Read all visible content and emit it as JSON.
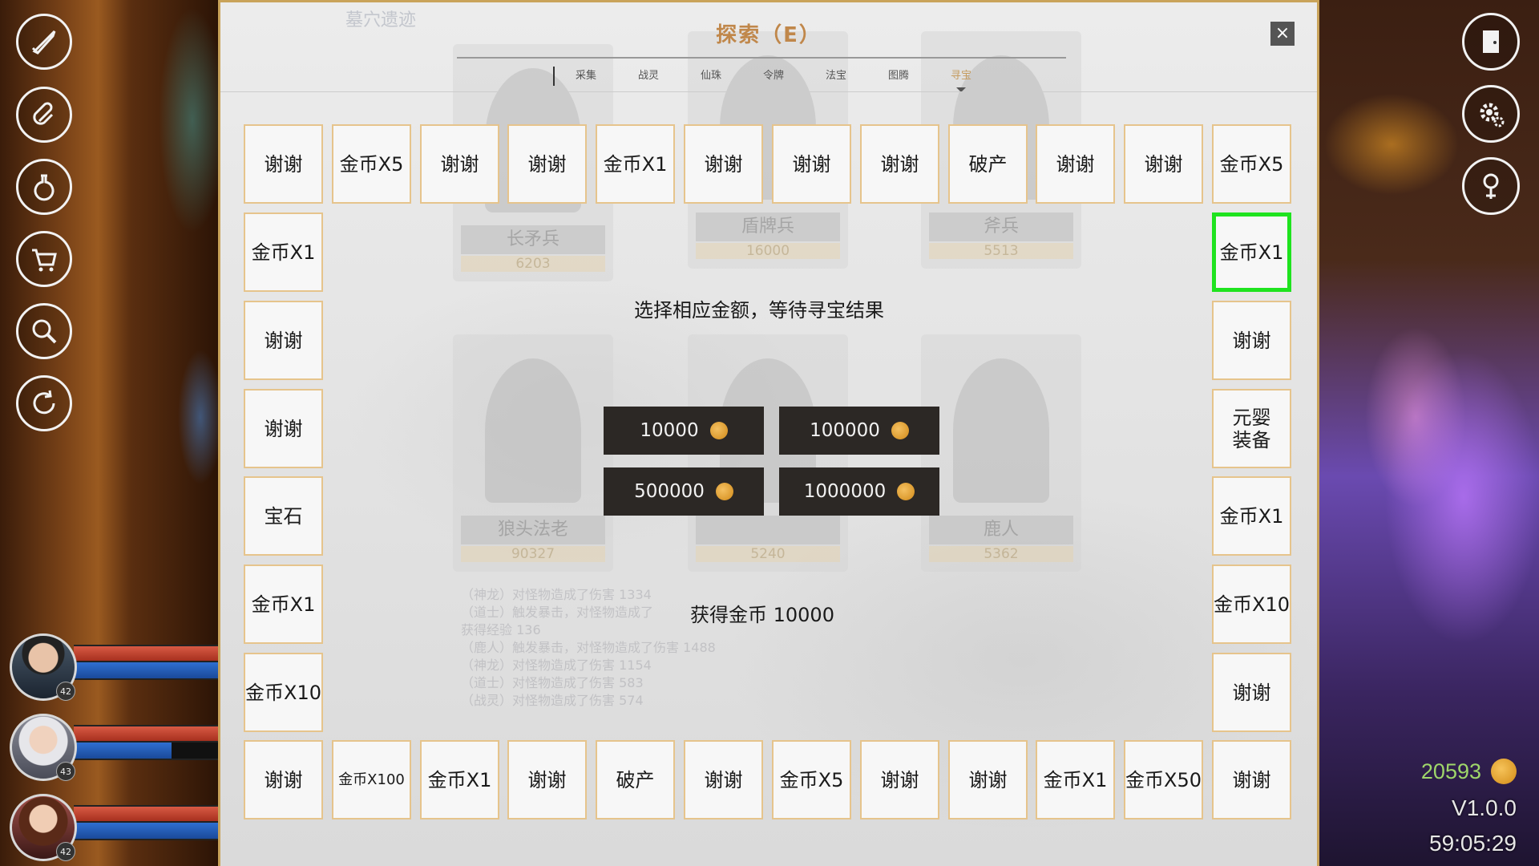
{
  "panel": {
    "title": "探索（E）",
    "ghost_title": "墓穴遗迹",
    "close_label": "×",
    "tabs": [
      {
        "label": "采集"
      },
      {
        "label": "战灵"
      },
      {
        "label": "仙珠"
      },
      {
        "label": "令牌"
      },
      {
        "label": "法宝"
      },
      {
        "label": "图腾"
      },
      {
        "label": "寻宝",
        "active": true
      }
    ],
    "instruction": "选择相应金额，等待寻宝结果",
    "result": "获得金币 10000",
    "bets": [
      {
        "amount": "10000"
      },
      {
        "amount": "100000"
      },
      {
        "amount": "500000"
      },
      {
        "amount": "1000000"
      }
    ]
  },
  "board": {
    "top": [
      "谢谢",
      "金币X5",
      "谢谢",
      "谢谢",
      "金币X1",
      "谢谢",
      "谢谢",
      "谢谢",
      "破产",
      "谢谢",
      "谢谢",
      "金币X5"
    ],
    "bottom": [
      "谢谢",
      "金币X100",
      "金币X1",
      "谢谢",
      "破产",
      "谢谢",
      "金币X5",
      "谢谢",
      "谢谢",
      "金币X1",
      "金币X50",
      "谢谢"
    ],
    "left": [
      "金币X1",
      "谢谢",
      "谢谢",
      "宝石",
      "金币X1",
      "金币X10"
    ],
    "right": [
      "金币X1",
      "谢谢",
      "元婴装备",
      "金币X1",
      "金币X10",
      "谢谢"
    ],
    "selected": "right-0"
  },
  "background_cards": [
    {
      "name": "长矛兵",
      "value": "6203"
    },
    {
      "name": "盾牌兵",
      "value": "16000"
    },
    {
      "name": "斧兵",
      "value": "5513"
    },
    {
      "name": "狼头法老",
      "value": "90327"
    },
    {
      "name": "",
      "value": "5240"
    },
    {
      "name": "鹿人",
      "value": "5362"
    }
  ],
  "background_log": [
    "（神龙）对怪物造成了伤害 1334",
    "（道士）触发暴击，对怪物造成了",
    "获得经验 136",
    "（鹿人）触发暴击，对怪物造成了伤害 1488",
    "（神龙）对怪物造成了伤害 1154",
    "（道士）对怪物造成了伤害 583",
    "（战灵）对怪物造成了伤害 574"
  ],
  "party": [
    {
      "level": "42",
      "mp_fraction": 1.0
    },
    {
      "level": "43",
      "mp_fraction": 0.68
    },
    {
      "level": "42",
      "mp_fraction": 1.0
    }
  ],
  "hud": {
    "gold": "20593",
    "version": "V1.0.0",
    "clock": "59:05:29"
  },
  "left_icons": [
    "sword-icon",
    "paperclip-icon",
    "potion-flask-icon",
    "shopping-cart-icon",
    "magnifier-icon",
    "refresh-icon"
  ],
  "right_icons": [
    "door-exit-icon",
    "settings-gear-icon",
    "location-pin-icon"
  ],
  "colors": {
    "accent_gold": "#c0874a",
    "cell_border": "#e6c48c",
    "selected_border": "#1fe31f",
    "bet_button": "#2c2825",
    "gold_text": "#9fd66a"
  }
}
